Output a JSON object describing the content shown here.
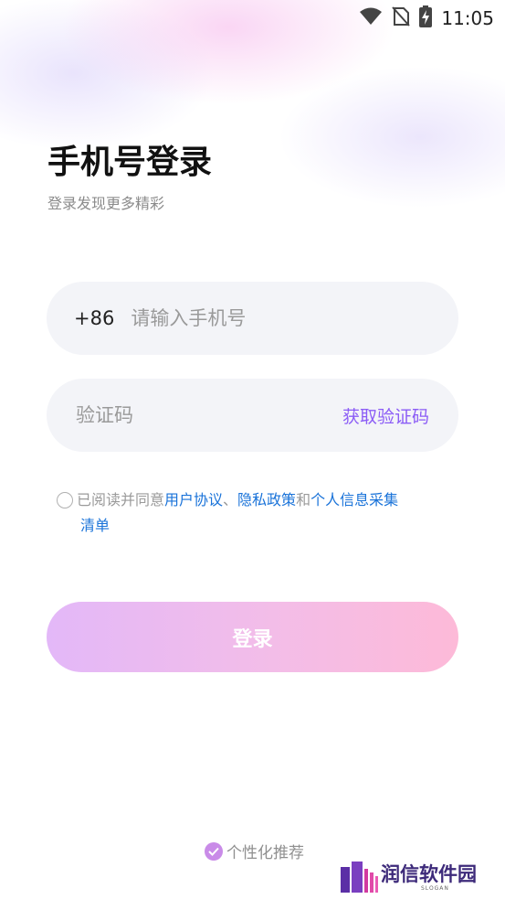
{
  "status_bar": {
    "time": "11:05",
    "icons": [
      "wifi-icon",
      "no-sim-icon",
      "battery-charging-icon"
    ]
  },
  "header": {
    "title": "手机号登录",
    "subtitle": "登录发现更多精彩"
  },
  "phone": {
    "country_code": "+86",
    "placeholder": "请输入手机号",
    "value": ""
  },
  "code": {
    "placeholder": "验证码",
    "value": "",
    "get_code_label": "获取验证码"
  },
  "agreement": {
    "checked": false,
    "prefix": "已阅读并同意",
    "user_agreement": "用户协议",
    "sep": "、",
    "privacy_policy": "隐私政策",
    "and": "和",
    "info_collection_1": "个人信息采集",
    "info_collection_2": "清单"
  },
  "login_button": {
    "label": "登录"
  },
  "personalized": {
    "label": "个性化推荐",
    "checked": true
  },
  "watermark": {
    "text": "润信软件园",
    "sub": "SLOGAN"
  },
  "colors": {
    "accent_purple": "#8b5cf6",
    "link_blue": "#1a73d9",
    "button_gradient_start": "#e3b8f8",
    "button_gradient_end": "#fdbad8"
  }
}
